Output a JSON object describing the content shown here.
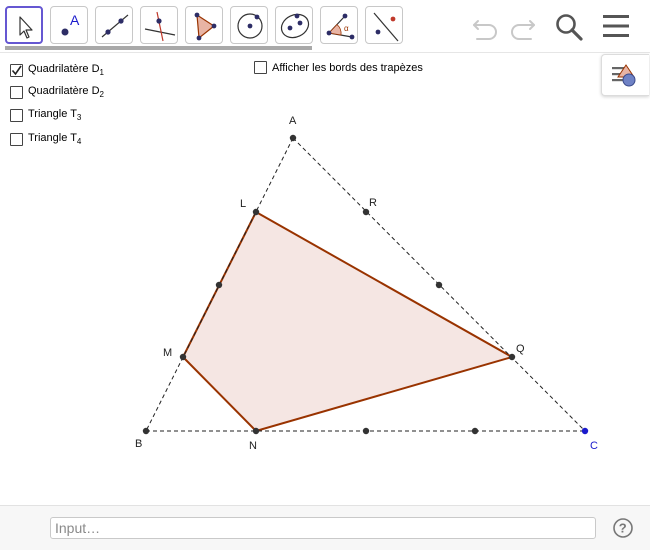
{
  "toolbar": {
    "tools": [
      {
        "name": "move-tool-icon",
        "active": true
      },
      {
        "name": "point-tool-icon",
        "letter": "A"
      },
      {
        "name": "line-tool-icon"
      },
      {
        "name": "perpendicular-line-tool-icon"
      },
      {
        "name": "polygon-tool-icon"
      },
      {
        "name": "circle-center-point-tool-icon"
      },
      {
        "name": "conic-tool-icon"
      },
      {
        "name": "angle-tool-icon"
      },
      {
        "name": "reflect-tool-icon"
      }
    ],
    "right_icons": [
      "undo-icon",
      "redo-icon",
      "search-icon",
      "menu-icon"
    ]
  },
  "checkboxes": [
    {
      "label": "Quadrilatère D",
      "sub": "1",
      "checked": true
    },
    {
      "label": "Quadrilatère D",
      "sub": "2",
      "checked": false
    },
    {
      "label": "Triangle T",
      "sub": "3",
      "checked": false
    },
    {
      "label": "Triangle T",
      "sub": "4",
      "checked": false
    }
  ],
  "trapezoid_checkbox": {
    "label": "Afficher les bords des trapèzes",
    "checked": false
  },
  "points": {
    "A": "A",
    "B": "B",
    "C": "C",
    "L": "L",
    "M": "M",
    "N": "N",
    "Q": "Q",
    "R": "R"
  },
  "colors": {
    "polygon_stroke": "#993300",
    "polygon_fill": "#f5e6e3",
    "point_dark": "#333333",
    "point_blue": "#1a1acc",
    "dashed_line": "#222222",
    "active_tool_border": "#6557d2"
  },
  "input_bar": {
    "placeholder": "Input…",
    "value": ""
  }
}
